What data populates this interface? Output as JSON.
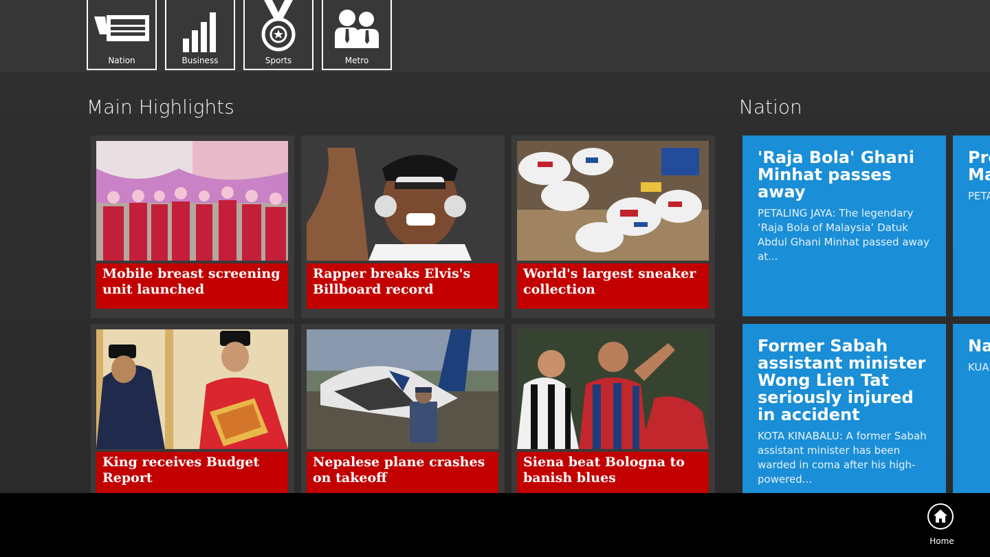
{
  "categories": [
    {
      "label": "Nation",
      "icon": "newspaper-icon"
    },
    {
      "label": "Business",
      "icon": "bar-chart-icon"
    },
    {
      "label": "Sports",
      "icon": "medal-icon"
    },
    {
      "label": "Metro",
      "icon": "people-icon"
    }
  ],
  "main_highlights": {
    "title": "Main Highlights",
    "stories": [
      {
        "headline": "Mobile breast screening unit launched",
        "image": "group-photo-pink-banner"
      },
      {
        "headline": "Rapper breaks Elvis's Billboard record",
        "image": "rapper-headphones"
      },
      {
        "headline": "World's largest sneaker collection",
        "image": "sneakers-on-shelf"
      },
      {
        "headline": "King receives Budget Report",
        "image": "officials-handing-folder"
      },
      {
        "headline": "Nepalese plane crashes on takeoff",
        "image": "plane-wreckage"
      },
      {
        "headline": "Siena beat Bologna to banish blues",
        "image": "football-players"
      }
    ]
  },
  "nation": {
    "title": "Nation",
    "stories": [
      {
        "headline": "'Raja Bola' Ghani Minhat passes away",
        "summary": "PETALING JAYA: The legendary ‘Raja Bola of Malaysia’ Datuk Abdul Ghani Minhat passed away at..."
      },
      {
        "headline": "Former Sabah assistant minister Wong Lien Tat seriously injured in accident",
        "summary": "KOTA KINABALU: A former Sabah assistant minister has been warded in coma after his high-powered..."
      },
      {
        "headline": "Pro... see... fou... Ma... wi...",
        "summary": "PETA... Mala... stud... cam..."
      },
      {
        "headline": "Na... tra... Co...",
        "summary": "KUA... thre... kidn... natio..."
      }
    ]
  },
  "app_bar": {
    "home_label": "Home"
  },
  "colors": {
    "caption_red": "#c20000",
    "nation_blue": "#1a8ed6",
    "top_bar": "#363636"
  }
}
